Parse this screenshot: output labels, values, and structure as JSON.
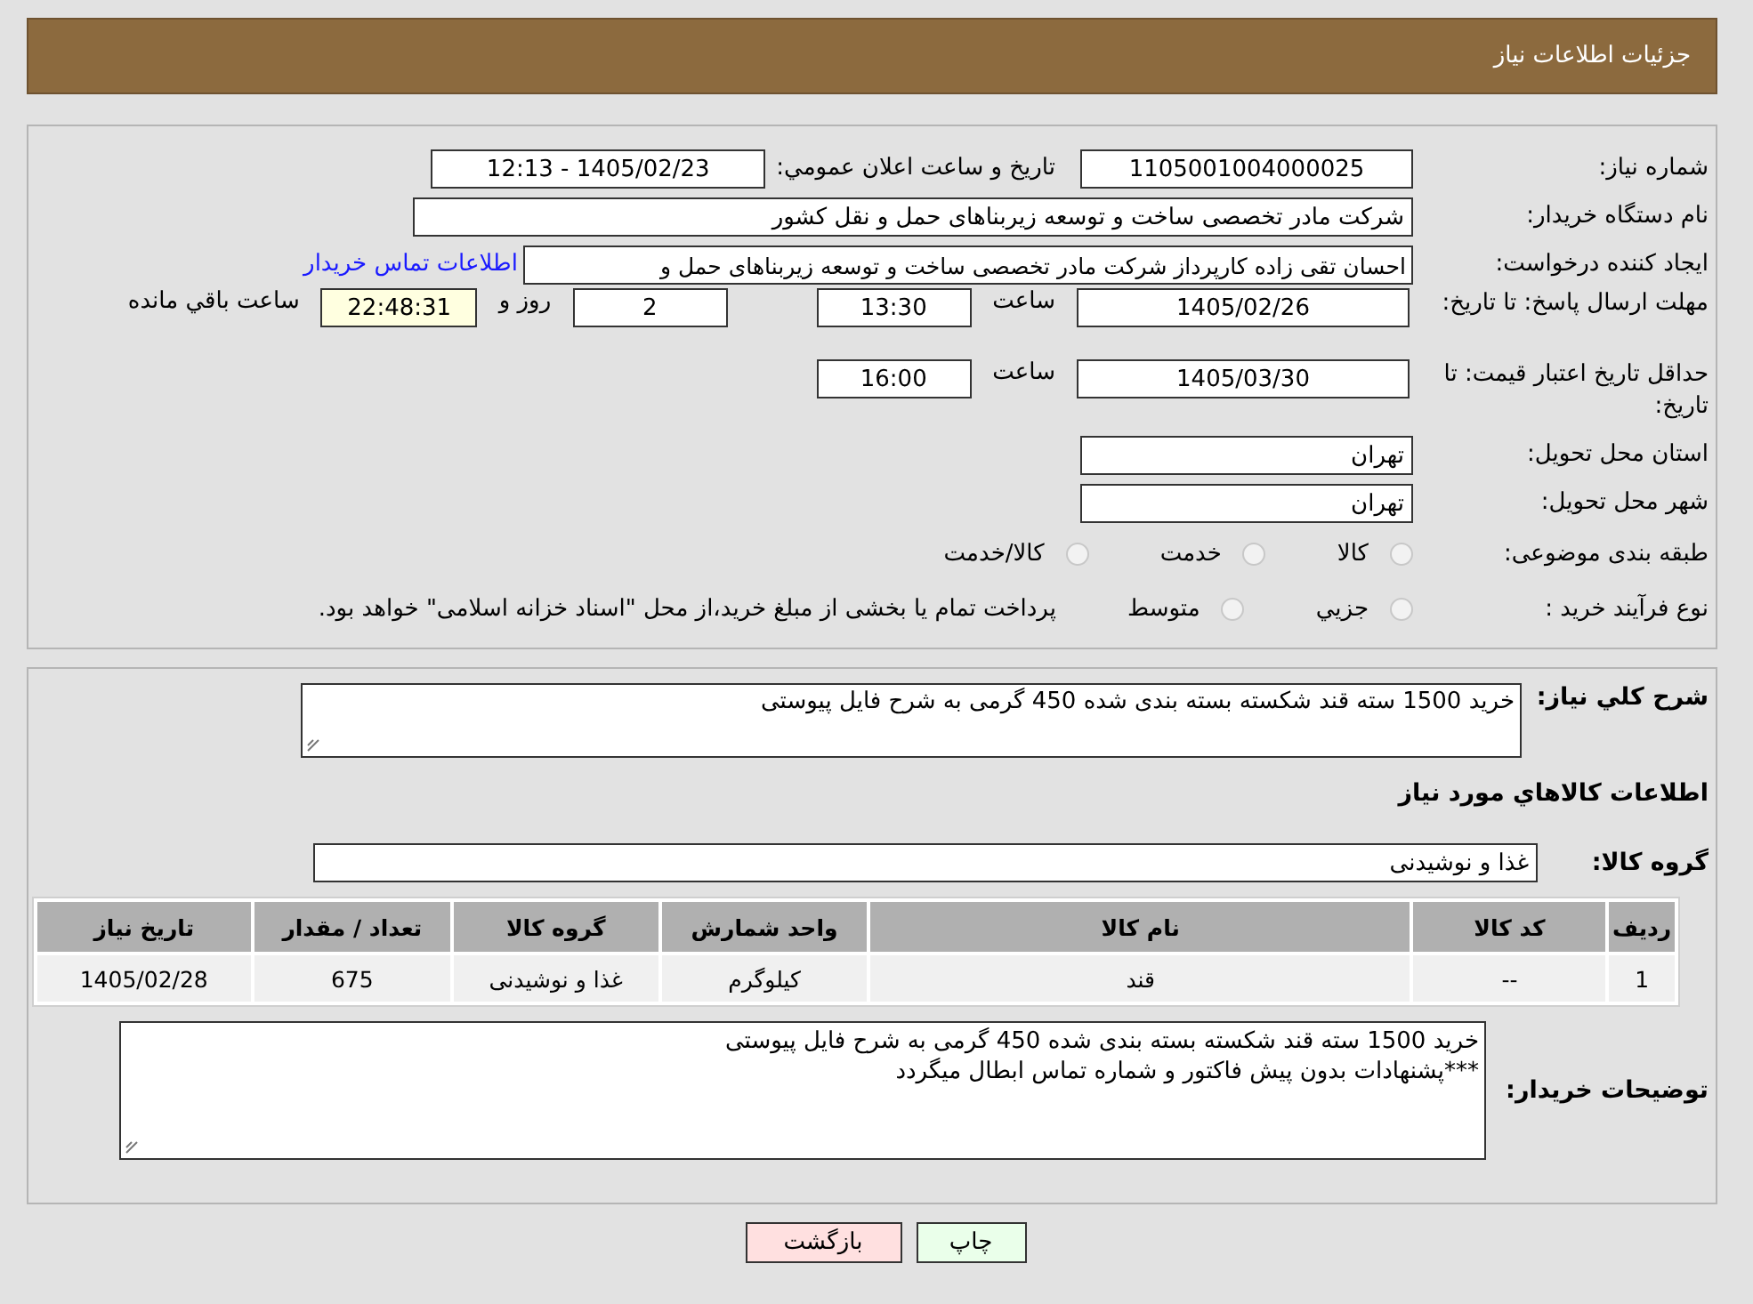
{
  "header": {
    "title": "جزئیات اطلاعات نیاز"
  },
  "details": {
    "need_number": {
      "label": "شماره نیاز:",
      "value": "1105001004000025"
    },
    "announce": {
      "label": "تاريخ و ساعت اعلان عمومي:",
      "value": "1405/02/23 - 12:13"
    },
    "buyer": {
      "label": "نام دستگاه خریدار:",
      "value": "شرکت مادر تخصصی ساخت و توسعه زیربناهای حمل و نقل کشور"
    },
    "creator": {
      "label": "ایجاد کننده درخواست:",
      "value": "احسان تقی زاده کارپرداز شرکت مادر تخصصی ساخت و توسعه زیربناهای حمل و",
      "link": "اطلاعات تماس خريدار"
    },
    "deadline": {
      "label": "مهلت ارسال پاسخ: تا تاریخ:",
      "date": "1405/02/26",
      "time_label": "ساعت",
      "time": "13:30",
      "days": "2",
      "days_label": "روز و",
      "remaining": "22:48:31",
      "remaining_label": "ساعت باقي مانده"
    },
    "validity": {
      "label": "حداقل تاریخ اعتبار قیمت: تا تاریخ:",
      "date": "1405/03/30",
      "time_label": "ساعت",
      "time": "16:00"
    },
    "province": {
      "label": "استان محل تحویل:",
      "value": "تهران"
    },
    "city": {
      "label": "شهر محل تحویل:",
      "value": "تهران"
    },
    "category": {
      "label": "طبقه بندی موضوعی:",
      "options": [
        {
          "label": "کالا",
          "selected": false
        },
        {
          "label": "خدمت",
          "selected": false
        },
        {
          "label": "کالا/خدمت",
          "selected": false
        }
      ]
    },
    "process": {
      "label": "نوع فرآیند خرید :",
      "options": [
        {
          "label": "جزيي",
          "selected": false
        },
        {
          "label": "متوسط",
          "selected": false
        }
      ],
      "note": "پرداخت تمام یا بخشی از مبلغ خرید،از محل \"اسناد خزانه اسلامی\" خواهد بود."
    }
  },
  "goods": {
    "summary": {
      "label": "شرح کلي نیاز:",
      "value": "خرید 1500 سته قند شکسته بسته بندی شده 450 گرمی به شرح فایل پیوستی"
    },
    "section_title": "اطلاعات کالاهاي مورد نیاز",
    "group": {
      "label": "گروه کالا:",
      "value": "غذا و نوشیدنی"
    },
    "table": {
      "columns": [
        "ردیف",
        "کد کالا",
        "نام کالا",
        "واحد شمارش",
        "گروه کالا",
        "تعداد / مقدار",
        "تاریخ نیاز"
      ],
      "rows": [
        [
          "1",
          "--",
          "قند",
          "کیلوگرم",
          "غذا و نوشیدنی",
          "675",
          "1405/02/28"
        ]
      ]
    },
    "notes": {
      "label": "توضیحات خریدار:",
      "lines": [
        "خرید 1500 سته قند شکسته بسته بندی شده 450 گرمی به شرح فایل پیوستی",
        "***پشنهادات بدون پیش فاکتور و شماره تماس ابطال میگردد"
      ]
    }
  },
  "buttons": [
    {
      "label": "چاپ",
      "kind": "print"
    },
    {
      "label": "بازگشت",
      "kind": "back"
    }
  ]
}
